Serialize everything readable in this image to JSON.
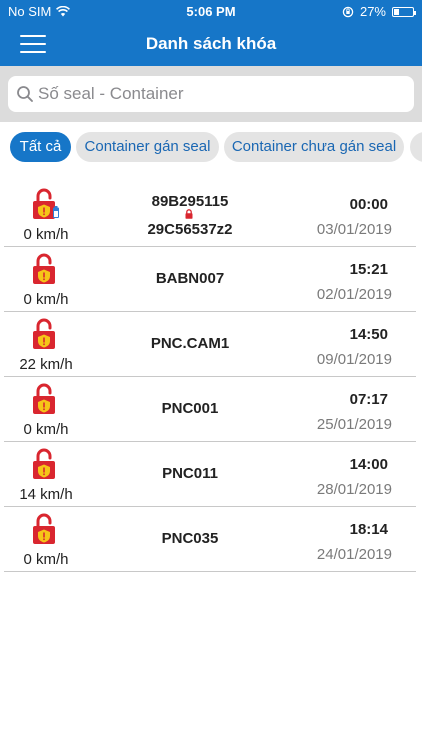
{
  "status": {
    "carrier": "No SIM",
    "time": "5:06 PM",
    "battery": "27%",
    "battery_level": 0.27
  },
  "nav": {
    "title": "Danh sách khóa",
    "menu_icon": "hamburger-menu-icon"
  },
  "search": {
    "placeholder": "Số seal - Container",
    "value": ""
  },
  "tabs": [
    {
      "label": "Tất cả",
      "active": true
    },
    {
      "label": "Container gán seal",
      "active": false
    },
    {
      "label": "Container chưa gán seal",
      "active": false
    }
  ],
  "colors": {
    "primary": "#1676c8",
    "lock_red": "#d9262f",
    "warning_yellow": "#f5c518",
    "divider": "#c8c8c8"
  },
  "rows": [
    {
      "code": "89B295115",
      "code2": "29C56537z2",
      "speed": "0 km/h",
      "time": "00:00",
      "date": "03/01/2019",
      "has_battery": true,
      "has_container_lock": true
    },
    {
      "code": "BABN007",
      "speed": "0 km/h",
      "time": "15:21",
      "date": "02/01/2019"
    },
    {
      "code": "PNC.CAM1",
      "speed": "22 km/h",
      "time": "14:50",
      "date": "09/01/2019"
    },
    {
      "code": "PNC001",
      "speed": "0 km/h",
      "time": "07:17",
      "date": "25/01/2019"
    },
    {
      "code": "PNC011",
      "speed": "14 km/h",
      "time": "14:00",
      "date": "28/01/2019"
    },
    {
      "code": "PNC035",
      "speed": "0 km/h",
      "time": "18:14",
      "date": "24/01/2019"
    }
  ]
}
